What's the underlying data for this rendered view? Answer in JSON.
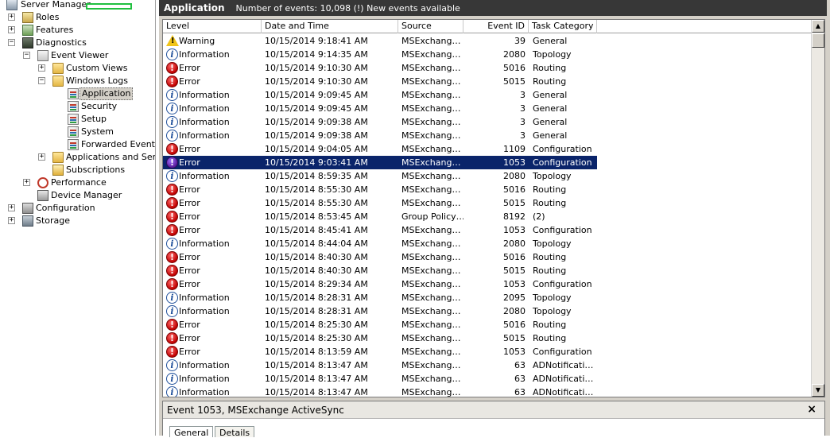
{
  "tree": {
    "server_manager": "Server Manager",
    "roles": "Roles",
    "features": "Features",
    "diagnostics": "Diagnostics",
    "event_viewer": "Event Viewer",
    "custom_views": "Custom Views",
    "windows_logs": "Windows Logs",
    "application": "Application",
    "security": "Security",
    "setup": "Setup",
    "system": "System",
    "forwarded_events": "Forwarded Events",
    "apps_services": "Applications and Servic",
    "subscriptions": "Subscriptions",
    "performance": "Performance",
    "device_manager": "Device Manager",
    "configuration": "Configuration",
    "storage": "Storage",
    "plus": "+",
    "minus": "−"
  },
  "titlebar": {
    "title": "Application",
    "summary": "Number of events: 10,098 (!) New events available"
  },
  "columns": {
    "level": "Level",
    "date": "Date and Time",
    "source": "Source",
    "event_id": "Event ID",
    "task": "Task Category"
  },
  "events": [
    {
      "level": "Warning",
      "date": "10/15/2014 9:18:41 AM",
      "source": "MSExchang…",
      "id": "39",
      "task": "General"
    },
    {
      "level": "Information",
      "date": "10/15/2014 9:14:35 AM",
      "source": "MSExchang…",
      "id": "2080",
      "task": "Topology"
    },
    {
      "level": "Error",
      "date": "10/15/2014 9:10:30 AM",
      "source": "MSExchang…",
      "id": "5016",
      "task": "Routing"
    },
    {
      "level": "Error",
      "date": "10/15/2014 9:10:30 AM",
      "source": "MSExchang…",
      "id": "5015",
      "task": "Routing"
    },
    {
      "level": "Information",
      "date": "10/15/2014 9:09:45 AM",
      "source": "MSExchang…",
      "id": "3",
      "task": "General"
    },
    {
      "level": "Information",
      "date": "10/15/2014 9:09:45 AM",
      "source": "MSExchang…",
      "id": "3",
      "task": "General"
    },
    {
      "level": "Information",
      "date": "10/15/2014 9:09:38 AM",
      "source": "MSExchang…",
      "id": "3",
      "task": "General"
    },
    {
      "level": "Information",
      "date": "10/15/2014 9:09:38 AM",
      "source": "MSExchang…",
      "id": "3",
      "task": "General"
    },
    {
      "level": "Error",
      "date": "10/15/2014 9:04:05 AM",
      "source": "MSExchang…",
      "id": "1109",
      "task": "Configuration"
    },
    {
      "level": "Error",
      "date": "10/15/2014 9:03:41 AM",
      "source": "MSExchang…",
      "id": "1053",
      "task": "Configuration",
      "selected": true
    },
    {
      "level": "Information",
      "date": "10/15/2014 8:59:35 AM",
      "source": "MSExchang…",
      "id": "2080",
      "task": "Topology"
    },
    {
      "level": "Error",
      "date": "10/15/2014 8:55:30 AM",
      "source": "MSExchang…",
      "id": "5016",
      "task": "Routing"
    },
    {
      "level": "Error",
      "date": "10/15/2014 8:55:30 AM",
      "source": "MSExchang…",
      "id": "5015",
      "task": "Routing"
    },
    {
      "level": "Error",
      "date": "10/15/2014 8:53:45 AM",
      "source": "Group Policy…",
      "id": "8192",
      "task": "(2)"
    },
    {
      "level": "Error",
      "date": "10/15/2014 8:45:41 AM",
      "source": "MSExchang…",
      "id": "1053",
      "task": "Configuration"
    },
    {
      "level": "Information",
      "date": "10/15/2014 8:44:04 AM",
      "source": "MSExchang…",
      "id": "2080",
      "task": "Topology"
    },
    {
      "level": "Error",
      "date": "10/15/2014 8:40:30 AM",
      "source": "MSExchang…",
      "id": "5016",
      "task": "Routing"
    },
    {
      "level": "Error",
      "date": "10/15/2014 8:40:30 AM",
      "source": "MSExchang…",
      "id": "5015",
      "task": "Routing"
    },
    {
      "level": "Error",
      "date": "10/15/2014 8:29:34 AM",
      "source": "MSExchang…",
      "id": "1053",
      "task": "Configuration"
    },
    {
      "level": "Information",
      "date": "10/15/2014 8:28:31 AM",
      "source": "MSExchang…",
      "id": "2095",
      "task": "Topology"
    },
    {
      "level": "Information",
      "date": "10/15/2014 8:28:31 AM",
      "source": "MSExchang…",
      "id": "2080",
      "task": "Topology"
    },
    {
      "level": "Error",
      "date": "10/15/2014 8:25:30 AM",
      "source": "MSExchang…",
      "id": "5016",
      "task": "Routing"
    },
    {
      "level": "Error",
      "date": "10/15/2014 8:25:30 AM",
      "source": "MSExchang…",
      "id": "5015",
      "task": "Routing"
    },
    {
      "level": "Error",
      "date": "10/15/2014 8:13:59 AM",
      "source": "MSExchang…",
      "id": "1053",
      "task": "Configuration"
    },
    {
      "level": "Information",
      "date": "10/15/2014 8:13:47 AM",
      "source": "MSExchang…",
      "id": "63",
      "task": "ADNotificati…"
    },
    {
      "level": "Information",
      "date": "10/15/2014 8:13:47 AM",
      "source": "MSExchang…",
      "id": "63",
      "task": "ADNotificati…"
    },
    {
      "level": "Information",
      "date": "10/15/2014 8:13:47 AM",
      "source": "MSExchang…",
      "id": "63",
      "task": "ADNotificati…"
    }
  ],
  "icons": {
    "error_glyph": "!",
    "info_glyph": "i",
    "scroll_up": "▲",
    "scroll_down": "▼",
    "close": "×"
  },
  "details": {
    "title": "Event 1053, MSExchange ActiveSync",
    "tab_general": "General",
    "tab_details": "Details"
  }
}
